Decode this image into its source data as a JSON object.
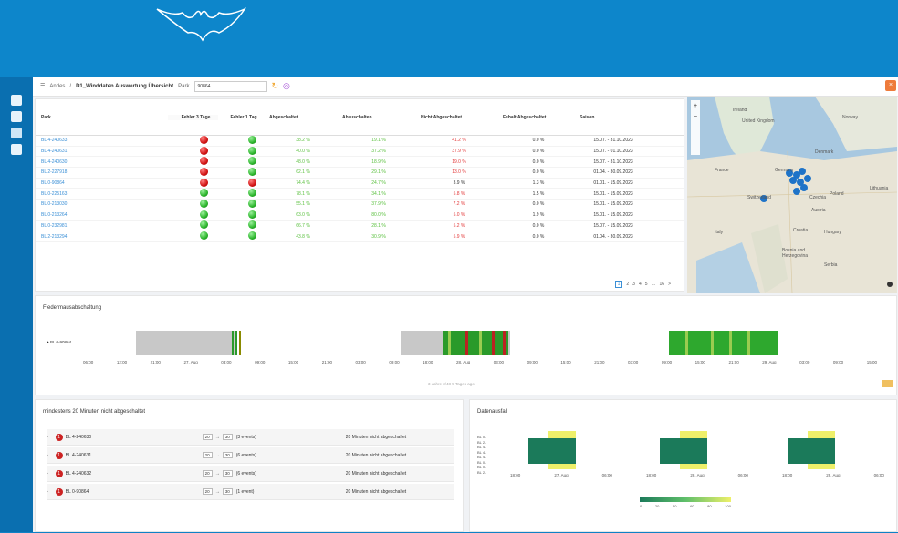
{
  "topbar": {
    "home": "Andes",
    "sep": "/",
    "title": "D1_Winddaten Auswertung Übersicht",
    "park_label": "Park",
    "park_value": "90864",
    "close": "×"
  },
  "table": {
    "headers": [
      "Park",
      "Fehler 3 Tage",
      "Fehler 1 Tag",
      "Abgeschaltet",
      "Abzuschalten",
      "Nicht Abgeschaltet",
      "Fehalt Abgeschaltet",
      "Saison"
    ],
    "rows": [
      {
        "park": "BL 4-240633",
        "f3": "red",
        "f1": "green",
        "abg": "38.2 %",
        "abz": "19.1 %",
        "nicht": "41.2 %",
        "fehalt": "0.0 %",
        "saison": "15.07. - 31.10.2023",
        "nc": "rv"
      },
      {
        "park": "BL 4-240631",
        "f3": "red",
        "f1": "green",
        "abg": "40.0 %",
        "abz": "37.2 %",
        "nicht": "37.9 %",
        "fehalt": "0.0 %",
        "saison": "15.07. - 01.10.2023",
        "nc": "rv"
      },
      {
        "park": "BL 4-240630",
        "f3": "red",
        "f1": "green",
        "abg": "48.0 %",
        "abz": "18.9 %",
        "nicht": "19.0 %",
        "fehalt": "0.0 %",
        "saison": "15.07. - 31.10.2023",
        "nc": "rv"
      },
      {
        "park": "BL 2-227918",
        "f3": "red",
        "f1": "green",
        "abg": "62.1 %",
        "abz": "29.1 %",
        "nicht": "13.0 %",
        "fehalt": "0.0 %",
        "saison": "01.04. - 30.09.2023",
        "nc": "rv"
      },
      {
        "park": "BL 0-90864",
        "f3": "red",
        "f1": "red",
        "abg": "74.4 %",
        "abz": "24.7 %",
        "nicht": "3.9 %",
        "fehalt": "1.3 %",
        "saison": "01.01. - 15.09.2023",
        "nc": "bv"
      },
      {
        "park": "BL 0-225163",
        "f3": "green",
        "f1": "green",
        "abg": "78.1 %",
        "abz": "34.1 %",
        "nicht": "5.8 %",
        "fehalt": "1.5 %",
        "saison": "15.01. - 15.09.2023",
        "nc": "rv"
      },
      {
        "park": "BL 0-213030",
        "f3": "green",
        "f1": "green",
        "abg": "55.1 %",
        "abz": "37.9 %",
        "nicht": "7.2 %",
        "fehalt": "0.0 %",
        "saison": "15.01. - 15.09.2023",
        "nc": "rv"
      },
      {
        "park": "BL 0-213264",
        "f3": "green",
        "f1": "green",
        "abg": "63.0 %",
        "abz": "80.0 %",
        "nicht": "5.0 %",
        "fehalt": "1.9 %",
        "saison": "15.01. - 15.09.2023",
        "nc": "rv"
      },
      {
        "park": "BL 0-232981",
        "f3": "green",
        "f1": "green",
        "abg": "66.7 %",
        "abz": "28.1 %",
        "nicht": "5.2 %",
        "fehalt": "0.0 %",
        "saison": "15.07. - 15.09.2023",
        "nc": "rv"
      },
      {
        "park": "BL 2-213294",
        "f3": "green",
        "f1": "green",
        "abg": "43.8 %",
        "abz": "30.9 %",
        "nicht": "5.9 %",
        "fehalt": "0.0 %",
        "saison": "01.04. - 30.09.2023",
        "nc": "rv"
      }
    ],
    "pages": [
      "1",
      "2",
      "3",
      "4",
      "5",
      "…",
      "16",
      ">"
    ],
    "footer": "9 Sekunden 8 Seite | 8 days ago"
  },
  "map": {
    "labels": [
      "Ireland",
      "United Kingdom",
      "Norway",
      "Denmark",
      "France",
      "Germany",
      "Poland",
      "Czechia",
      "Switzerland",
      "Austria",
      "Hungary",
      "Italy",
      "Croatia",
      "Serbia",
      "Bosnia and Herzegovina",
      "Lithuania"
    ]
  },
  "chart1": {
    "title": "Fledermausabschaltung",
    "series_label": "● BL 0-90864",
    "ticks": [
      "06:00",
      "12:00",
      "21:00",
      "27. Aug",
      "03:00",
      "09:00",
      "15:00",
      "21:00",
      "03:00",
      "09:00",
      "18:00",
      "28. Aug",
      "03:00",
      "09:00",
      "15:00",
      "21:00",
      "03:00",
      "09:00",
      "15:00",
      "21:00",
      "29. Aug",
      "03:00",
      "09:00",
      "15:00"
    ],
    "footer": "3 Jahre 2/48 5 Tages ago"
  },
  "chart2": {
    "title": "mindestens 20 Minuten nicht abgeschaltet",
    "rows": [
      {
        "park": "BL 4-240630",
        "badge": "1",
        "from": "20",
        "to": "30",
        "events": "(3 events)",
        "status": "20 Minuten nicht abgeschaltet"
      },
      {
        "park": "BL 4-240631",
        "badge": "1",
        "from": "20",
        "to": "30",
        "events": "(6 events)",
        "status": "20 Minuten nicht abgeschaltet"
      },
      {
        "park": "BL 4-240632",
        "badge": "1",
        "from": "20",
        "to": "30",
        "events": "(6 events)",
        "status": "20 Minuten nicht abgeschaltet"
      },
      {
        "park": "BL 0-90864",
        "badge": "1",
        "from": "20",
        "to": "30",
        "events": "(1 event)",
        "status": "20 Minuten nicht abgeschaltet"
      }
    ]
  },
  "chart3": {
    "title": "Datenausfall",
    "ylabels": [
      "BL 0-",
      "BL 2-",
      "BL 4-",
      "BL 4-",
      "BL 4-",
      "BL 0-",
      "BL 0-",
      "BL 2-"
    ],
    "ticks": [
      "18:00",
      "27. Aug",
      "06:00",
      "18:00",
      "28. Aug",
      "06:00",
      "18:00",
      "29. Aug",
      "06:00"
    ],
    "legend": [
      "0",
      "20",
      "40",
      "60",
      "80",
      "100"
    ]
  }
}
